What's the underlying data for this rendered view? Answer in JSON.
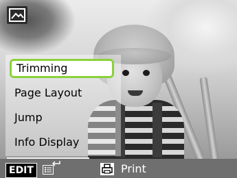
{
  "menu": {
    "items": [
      {
        "label": "Trimming",
        "selected": true
      },
      {
        "label": "Page Layout",
        "selected": false
      },
      {
        "label": "Jump",
        "selected": false
      },
      {
        "label": "Info Display",
        "selected": false
      }
    ]
  },
  "bottom_bar": {
    "edit_label": "EDIT",
    "print_label": "Print"
  },
  "icons": {
    "top_left": "photo-icon",
    "list": "list-icon",
    "arrow": "return-arrow-icon",
    "print": "print-icon"
  },
  "colors": {
    "selection_border": "#8bd13a",
    "bottom_bar": "#6f6f6f"
  }
}
